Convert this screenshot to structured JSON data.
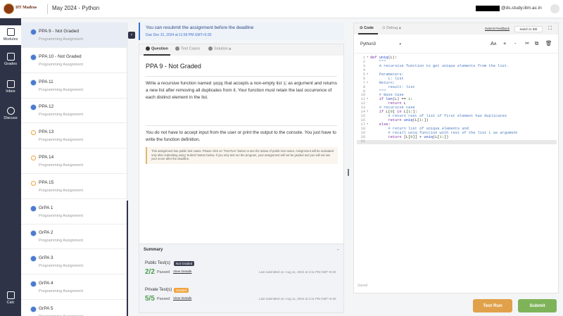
{
  "header": {
    "logo_text": "IIT Madras",
    "course_title": "May 2024 - Python",
    "email_suffix": "@ds.study.iitm.ac.in"
  },
  "rail": {
    "modules": "Modules",
    "grades": "Grades",
    "inbox": "Inbox",
    "discuss": "Discuss",
    "calc": "Calc"
  },
  "assignments": [
    {
      "title": "PPA 9 - Not Graded",
      "sub": "Programming Assignment",
      "status": "done"
    },
    {
      "title": "PPA 10 - Not Graded",
      "sub": "Programming Assignment",
      "status": "done"
    },
    {
      "title": "PPA 11",
      "sub": "Programming Assignment",
      "status": "done"
    },
    {
      "title": "PPA 12",
      "sub": "Programming Assignment",
      "status": "done"
    },
    {
      "title": "PPA 13",
      "sub": "Programming Assignment",
      "status": "pending"
    },
    {
      "title": "PPA 14",
      "sub": "Programming Assignment",
      "status": "pending"
    },
    {
      "title": "PPA 15",
      "sub": "Programming Assignment",
      "status": "pending"
    },
    {
      "title": "GrPA 1",
      "sub": "Programming Assignment",
      "status": "done"
    },
    {
      "title": "GrPA 2",
      "sub": "Programming Assignment",
      "status": "done"
    },
    {
      "title": "GrPA 3",
      "sub": "Programming Assignment",
      "status": "done"
    },
    {
      "title": "GrPA 4",
      "sub": "Programming Assignment",
      "status": "done"
    },
    {
      "title": "GrPA 5",
      "sub": "Programming Assignment",
      "status": "done"
    }
  ],
  "banner": {
    "message": "You can resubmit the assignment before the deadline",
    "due": "Due Dec 31, 2024 at 11:59 PM GMT+5:30"
  },
  "question_tabs": {
    "question": "Question",
    "test_cases": "Test Cases",
    "solution": "Solution"
  },
  "question": {
    "title": "PPA 9 - Not Graded",
    "para1_a": "Write a recursive function named ",
    "para1_code": "uniq",
    "para1_b": " that accepts a non-empty list ",
    "para1_code2": "L",
    "para1_c": " as argument and returns a new list after removing all duplicates from it. Your function must retain the last occurrence of each distinct element in the list.",
    "para2": "You do not have to accept input from the user or print the output to the console. You just have to write the function definition.",
    "note": "This assignment has public test cases. Please click on \"Test Run\" button to see the status of public test cases. Assignment will be evaluated only after submitting using 'Submit' button below. If you only test run the program, your assignment will not be graded and you will not see your score after the deadline."
  },
  "summary": {
    "heading": "Summary",
    "public_label": "Public Test(s)",
    "public_badge": "Not Graded",
    "public_score": "2/2",
    "private_label": "Private Test(s)",
    "private_badge": "Graded",
    "private_score": "5/5",
    "passed": "Passed",
    "view_details": "View Details",
    "last_submitted": "Last submitted on: Aug 11, 2024 at 2:11 PM GMT+5:30"
  },
  "code_panel": {
    "tab_code": "Code",
    "tab_debug": "Debug",
    "submit_feedback": "Submit Feedback",
    "switch_ide": "Switch to IDE",
    "language": "Python3",
    "saved": "Saved"
  },
  "code_lines": [
    {
      "n": "1",
      "f": "▾",
      "html": "<span class='kw'>def</span> <span class='fn'>uniq</span>(L):"
    },
    {
      "n": "2",
      "f": "",
      "html": "    <span class='cm'>\"\"\"</span>"
    },
    {
      "n": "3",
      "f": "",
      "html": "    <span class='cm'>A recursive function to get unique elements from the list.</span>"
    },
    {
      "n": "4",
      "f": "",
      "html": ""
    },
    {
      "n": "5",
      "f": "▾",
      "html": "    <span class='cm'>Parameters:</span>"
    },
    {
      "n": "6",
      "f": "",
      "html": "        <span class='cm'>L: list</span>"
    },
    {
      "n": "7",
      "f": "▾",
      "html": "    <span class='cm'>Return:</span>"
    },
    {
      "n": "8",
      "f": "",
      "html": "        <span class='cm'>result: list</span>"
    },
    {
      "n": "9",
      "f": "",
      "html": "    <span class='cm'>\"\"\"</span>"
    },
    {
      "n": "10",
      "f": "",
      "html": "    <span class='cm'># Base Case</span>"
    },
    {
      "n": "11",
      "f": "▾",
      "html": "    <span class='kw'>if</span> <span class='fn'>len</span>(L) == <span class='nm'>1</span>:"
    },
    {
      "n": "12",
      "f": "",
      "html": "        <span class='kw'>return</span> L"
    },
    {
      "n": "13",
      "f": "",
      "html": "    <span class='cm'># recursive case</span>"
    },
    {
      "n": "14",
      "f": "▾",
      "html": "    <span class='kw'>if</span> L[<span class='nm'>0</span>] <span class='kw'>in</span> L[<span class='nm'>1</span>:]:"
    },
    {
      "n": "15",
      "f": "",
      "html": "        <span class='cm'># return rest of list if first element has duplicates</span>"
    },
    {
      "n": "16",
      "f": "",
      "html": "        <span class='kw'>return</span> <span class='fn'>uniq</span>(L[<span class='nm'>1</span>:])"
    },
    {
      "n": "17",
      "f": "▾",
      "html": "    <span class='kw'>else</span>:"
    },
    {
      "n": "18",
      "f": "",
      "html": "        <span class='cm'># return list of unique elements and</span>"
    },
    {
      "n": "19",
      "f": "",
      "html": "        <span class='cm'># recall uniq function with rest of the list L as argument</span>"
    },
    {
      "n": "20",
      "f": "",
      "html": "        <span class='kw'>return</span> [L[<span class='nm'>0</span>]] + <span class='fn'>uniq</span>(L[<span class='nm'>1</span>:])"
    },
    {
      "n": "21",
      "f": "",
      "html": ""
    }
  ],
  "buttons": {
    "test_run": "Test Run",
    "submit": "Submit"
  },
  "colors": {
    "rail": "#2e3347",
    "accent_blue": "#3b6fd0",
    "test_run": "#e0a14a",
    "submit": "#7fb35a",
    "passed_green": "#4d9c4d"
  }
}
